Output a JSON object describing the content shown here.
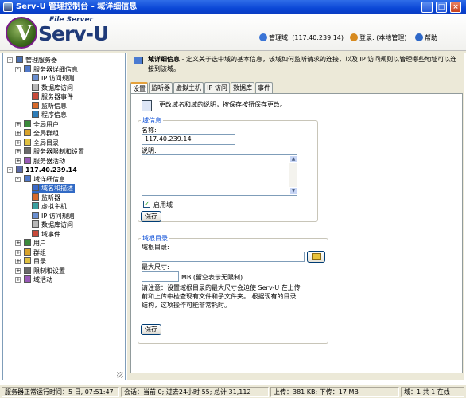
{
  "window": {
    "title": "Serv-U 管理控制台 - 域详细信息",
    "buttons": [
      "_",
      "□",
      "×"
    ]
  },
  "header": {
    "logo_top": "File Server",
    "logo_main": "Serv-U",
    "manage_domain": "管理域: (117.40.239.14)",
    "login": "登录: (本地管理)",
    "help": "帮助"
  },
  "tree": {
    "items": [
      {
        "label": "管理服务器",
        "level": 0,
        "exp": "-",
        "icon": "server-icon"
      },
      {
        "label": "服务器详细信息",
        "level": 1,
        "exp": "-",
        "icon": "server-details-icon"
      },
      {
        "label": "IP 访问规则",
        "level": 2,
        "icon": "ip-rules-icon"
      },
      {
        "label": "数据库访问",
        "level": 2,
        "icon": "database-icon"
      },
      {
        "label": "服务器事件",
        "level": 2,
        "icon": "events-icon"
      },
      {
        "label": "监听信息",
        "level": 2,
        "icon": "listener-icon"
      },
      {
        "label": "程序信息",
        "level": 2,
        "icon": "program-info-icon"
      },
      {
        "label": "全局用户",
        "level": 1,
        "exp": "+",
        "icon": "users-icon"
      },
      {
        "label": "全局群组",
        "level": 1,
        "exp": "+",
        "icon": "groups-icon"
      },
      {
        "label": "全局目录",
        "level": 1,
        "exp": "+",
        "icon": "directory-icon"
      },
      {
        "label": "服务器限制和设置",
        "level": 1,
        "exp": "+",
        "icon": "settings-icon"
      },
      {
        "label": "服务器活动",
        "level": 1,
        "exp": "+",
        "icon": "activity-icon"
      },
      {
        "label": "117.40.239.14",
        "level": 0,
        "exp": "-",
        "icon": "domain-icon",
        "bold": true
      },
      {
        "label": "域详细信息",
        "level": 1,
        "exp": "-",
        "icon": "domain-details-icon"
      },
      {
        "label": "域名和描述",
        "level": 2,
        "icon": "domain-name-icon",
        "selected": true
      },
      {
        "label": "监听器",
        "level": 2,
        "icon": "listener-icon"
      },
      {
        "label": "虚拟主机",
        "level": 2,
        "icon": "virtual-host-icon"
      },
      {
        "label": "IP 访问规则",
        "level": 2,
        "icon": "ip-rules-icon"
      },
      {
        "label": "数据库访问",
        "level": 2,
        "icon": "database-icon"
      },
      {
        "label": "域事件",
        "level": 2,
        "icon": "events-icon"
      },
      {
        "label": "用户",
        "level": 1,
        "exp": "+",
        "icon": "users-icon"
      },
      {
        "label": "群组",
        "level": 1,
        "exp": "+",
        "icon": "groups-icon"
      },
      {
        "label": "目录",
        "level": 1,
        "exp": "+",
        "icon": "directory-icon"
      },
      {
        "label": "限制和设置",
        "level": 1,
        "exp": "+",
        "icon": "settings-icon"
      },
      {
        "label": "域活动",
        "level": 1,
        "exp": "+",
        "icon": "activity-icon"
      }
    ]
  },
  "main": {
    "info_title": "域详细信息",
    "info_text": " - 定义关于选中域的基本信息，该域如何监听请求的连接，以及 IP 访问规则以管理哪些地址可以连接到该域。",
    "tabs": [
      "设置",
      "监听器",
      "虚拟主机",
      "IP 访问",
      "数据库",
      "事件"
    ],
    "description": "更改域名和域的说明，按保存按钮保存更改。",
    "domain_group": {
      "title": "域信息",
      "name_label": "名称:",
      "name_value": "117.40.239.14",
      "desc_label": "说明:",
      "enable_label": "启用域",
      "enabled": true,
      "save": "保存"
    },
    "root_group": {
      "title": "域根目录",
      "root_label": "域根目录:",
      "root_value": "",
      "max_label": "最大尺寸:",
      "max_value": "",
      "max_unit": "MB (留空表示无限制)",
      "note": "请注意：设置域根目录的最大尺寸会迫使 Serv-U 在上传前和上传中检查现有文件和子文件夹。 根据现有的目录结构，这项操作可能非常耗时。",
      "save": "保存"
    }
  },
  "status": {
    "uptime": "服务器正常运行时间：5 日, 07:51:47",
    "sessions": "会话：当前 0; 过去24小时 55; 总计 31,112",
    "transfer": "上传：381 KB; 下传：17 MB",
    "domains": "域：1 共 1 在线"
  }
}
